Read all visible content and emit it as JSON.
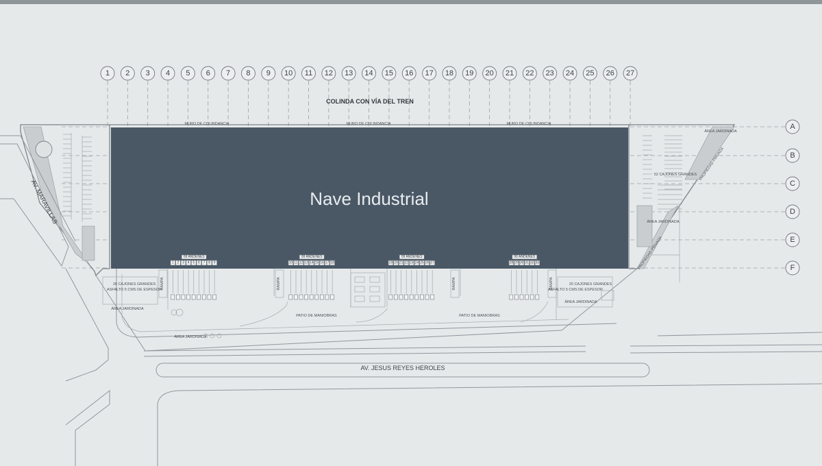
{
  "building": {
    "label": "Nave Industrial",
    "color": "#4a5866"
  },
  "grid": {
    "columns": [
      "1",
      "2",
      "3",
      "4",
      "5",
      "6",
      "7",
      "8",
      "9",
      "10",
      "11",
      "12",
      "13",
      "14",
      "15",
      "16",
      "17",
      "18",
      "19",
      "20",
      "21",
      "22",
      "23",
      "24",
      "25",
      "26",
      "27"
    ],
    "rows": [
      "A",
      "B",
      "C",
      "D",
      "E",
      "F"
    ]
  },
  "labels": {
    "north_boundary": "COLINDA CON VÍA DEL TREN",
    "street_west": "AV. MARAVILLAS",
    "street_south": "AV. JESUS REYES HEROLES",
    "boundary_wall": "MURO DE COLINDANCIA",
    "yard_left": "PATIO DE MANIOBRAS",
    "yard_right": "PATIO DE MANIOBRAS",
    "garden": "ÁREA JARDINADA",
    "ramp": "RAMPA",
    "parking_large_left": "28 CAJONES GRANDES",
    "parking_large_right": "20 CAJONES GRANDES",
    "parking_large_right_upper": "52 CAJONES GRANDES",
    "asphalt": "ASFALTO 5 CMS DE ESPESOR",
    "neighbor_property": "PROPIEDAD PRIVADA"
  },
  "docks": [
    {
      "label": "09 ANDENES",
      "numbers": [
        "1",
        "2",
        "3",
        "4",
        "5",
        "6",
        "7",
        "8",
        "9"
      ]
    },
    {
      "label": "09 ANDENES",
      "numbers": [
        "10",
        "11",
        "12",
        "13",
        "14",
        "15",
        "16",
        "17",
        "18"
      ]
    },
    {
      "label": "09 ANDENES",
      "numbers": [
        "19",
        "20",
        "21",
        "22",
        "23",
        "24",
        "25",
        "26",
        "27"
      ]
    },
    {
      "label": "06 ANDENES",
      "numbers": [
        "28",
        "29",
        "30",
        "31",
        "32",
        "33"
      ]
    }
  ]
}
